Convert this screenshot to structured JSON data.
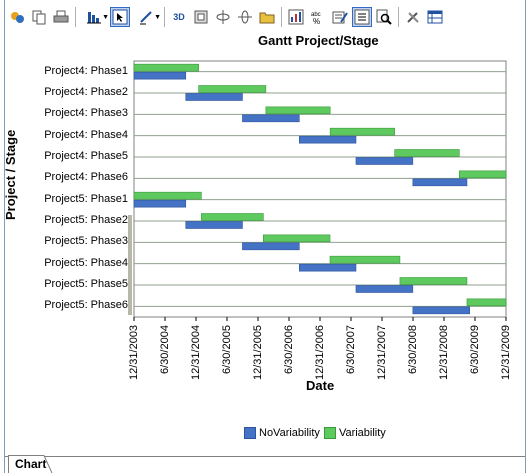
{
  "toolbar": {
    "buttons": [
      {
        "name": "wizard-icon"
      },
      {
        "name": "copy-icon"
      },
      {
        "name": "print-icon"
      },
      {
        "name": "chart-type-icon"
      },
      {
        "name": "select-icon"
      },
      {
        "name": "draw-icon"
      },
      {
        "name": "3d-icon"
      },
      {
        "name": "frame-icon"
      },
      {
        "name": "rotate-horizontal-icon"
      },
      {
        "name": "rotate-vertical-icon"
      },
      {
        "name": "open-icon"
      },
      {
        "name": "stats-icon"
      },
      {
        "name": "abc-icon"
      },
      {
        "name": "edit-icon"
      },
      {
        "name": "legend-icon"
      },
      {
        "name": "zoom-icon"
      },
      {
        "name": "tools-icon"
      },
      {
        "name": "data-grid-icon"
      }
    ],
    "label_3d": "3D"
  },
  "tabs": [
    {
      "label": "Chart"
    }
  ],
  "colors": {
    "novariability": "#4472c4",
    "variability": "#5ec95e",
    "grid": "#8fa08f"
  },
  "chart_data": {
    "type": "gantt",
    "title": "Gantt Project/Stage",
    "xlabel": "Date",
    "ylabel": "Project / Stage",
    "categories": [
      "Project4: Phase1",
      "Project4: Phase2",
      "Project4: Phase3",
      "Project4: Phase4",
      "Project4: Phase5",
      "Project4: Phase6",
      "Project5: Phase1",
      "Project5: Phase2",
      "Project5: Phase3",
      "Project5: Phase4",
      "Project5: Phase5",
      "Project5: Phase6"
    ],
    "x_ticks": [
      "12/31/2003",
      "6/30/2004",
      "12/31/2004",
      "6/30/2005",
      "12/31/2005",
      "6/30/2006",
      "12/31/2006",
      "6/30/2007",
      "12/31/2007",
      "6/30/2008",
      "12/31/2008",
      "6/30/2009",
      "12/31/2009"
    ],
    "xlim": [
      "2003-12-31",
      "2009-12-31"
    ],
    "legend": "bottom",
    "series": [
      {
        "name": "NoVariability",
        "tasks": [
          {
            "start": "2003-12-31",
            "end": "2004-10-31"
          },
          {
            "start": "2004-10-31",
            "end": "2005-09-30"
          },
          {
            "start": "2005-09-30",
            "end": "2006-08-31"
          },
          {
            "start": "2006-08-31",
            "end": "2007-07-31"
          },
          {
            "start": "2007-07-31",
            "end": "2008-06-30"
          },
          {
            "start": "2008-06-30",
            "end": "2009-05-15"
          },
          {
            "start": "2003-12-31",
            "end": "2004-10-31"
          },
          {
            "start": "2004-10-31",
            "end": "2005-09-30"
          },
          {
            "start": "2005-09-30",
            "end": "2006-08-31"
          },
          {
            "start": "2006-08-31",
            "end": "2007-07-31"
          },
          {
            "start": "2007-07-31",
            "end": "2008-06-30"
          },
          {
            "start": "2008-06-30",
            "end": "2009-05-31"
          }
        ]
      },
      {
        "name": "Variability",
        "tasks": [
          {
            "start": "2003-12-31",
            "end": "2005-01-15"
          },
          {
            "start": "2005-01-15",
            "end": "2006-02-15"
          },
          {
            "start": "2006-02-15",
            "end": "2007-03-01"
          },
          {
            "start": "2007-03-01",
            "end": "2008-03-15"
          },
          {
            "start": "2008-03-15",
            "end": "2009-03-31"
          },
          {
            "start": "2009-03-31",
            "end": "2010-04-30"
          },
          {
            "start": "2003-12-31",
            "end": "2005-01-31"
          },
          {
            "start": "2005-01-31",
            "end": "2006-01-31"
          },
          {
            "start": "2006-01-31",
            "end": "2007-02-28"
          },
          {
            "start": "2007-02-28",
            "end": "2008-04-15"
          },
          {
            "start": "2008-04-15",
            "end": "2009-05-15"
          },
          {
            "start": "2009-05-15",
            "end": "2010-07-15"
          }
        ]
      }
    ]
  }
}
